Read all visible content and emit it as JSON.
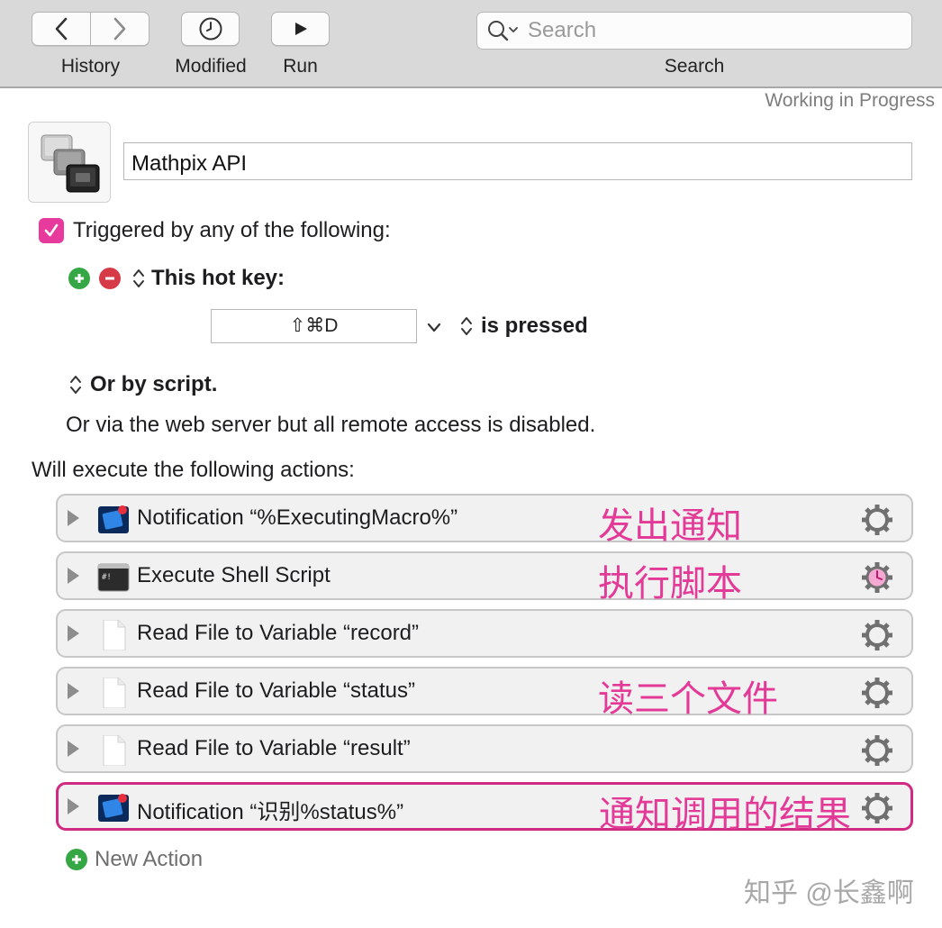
{
  "toolbar": {
    "history_label": "History",
    "modified_label": "Modified",
    "run_label": "Run",
    "search_label": "Search",
    "search_placeholder": "Search"
  },
  "status": "Working in Progress",
  "macro": {
    "name": "Mathpix API"
  },
  "trigger": {
    "enabled": true,
    "heading": "Triggered by any of the following:",
    "hotkey_label": "This hot key:",
    "hotkey_value": "⇧⌘D",
    "pressed_label": "is pressed",
    "script_label": "Or by script.",
    "web_server_text": "Or via the web server but all remote access is disabled."
  },
  "actions_heading": "Will execute the following actions:",
  "actions": [
    {
      "title": "Notification “%ExecutingMacro%”",
      "icon": "notification-icon",
      "note": "发出通知"
    },
    {
      "title": "Execute Shell Script",
      "icon": "terminal-icon",
      "note": "执行脚本"
    },
    {
      "title": "Read File to Variable “record”",
      "icon": "document-icon",
      "note": ""
    },
    {
      "title": "Read File to Variable “status”",
      "icon": "document-icon",
      "note": "读三个文件"
    },
    {
      "title": "Read File to Variable “result”",
      "icon": "document-icon",
      "note": ""
    },
    {
      "title": "Notification “识别%status%”",
      "icon": "notification-icon",
      "note": "通知调用的结果"
    }
  ],
  "new_action_label": "New Action",
  "watermark": "知乎 @长鑫啊",
  "colors": {
    "accent": "#e83a9c",
    "annotation": "#e33a98",
    "toolbar": "#d9d9d9"
  }
}
